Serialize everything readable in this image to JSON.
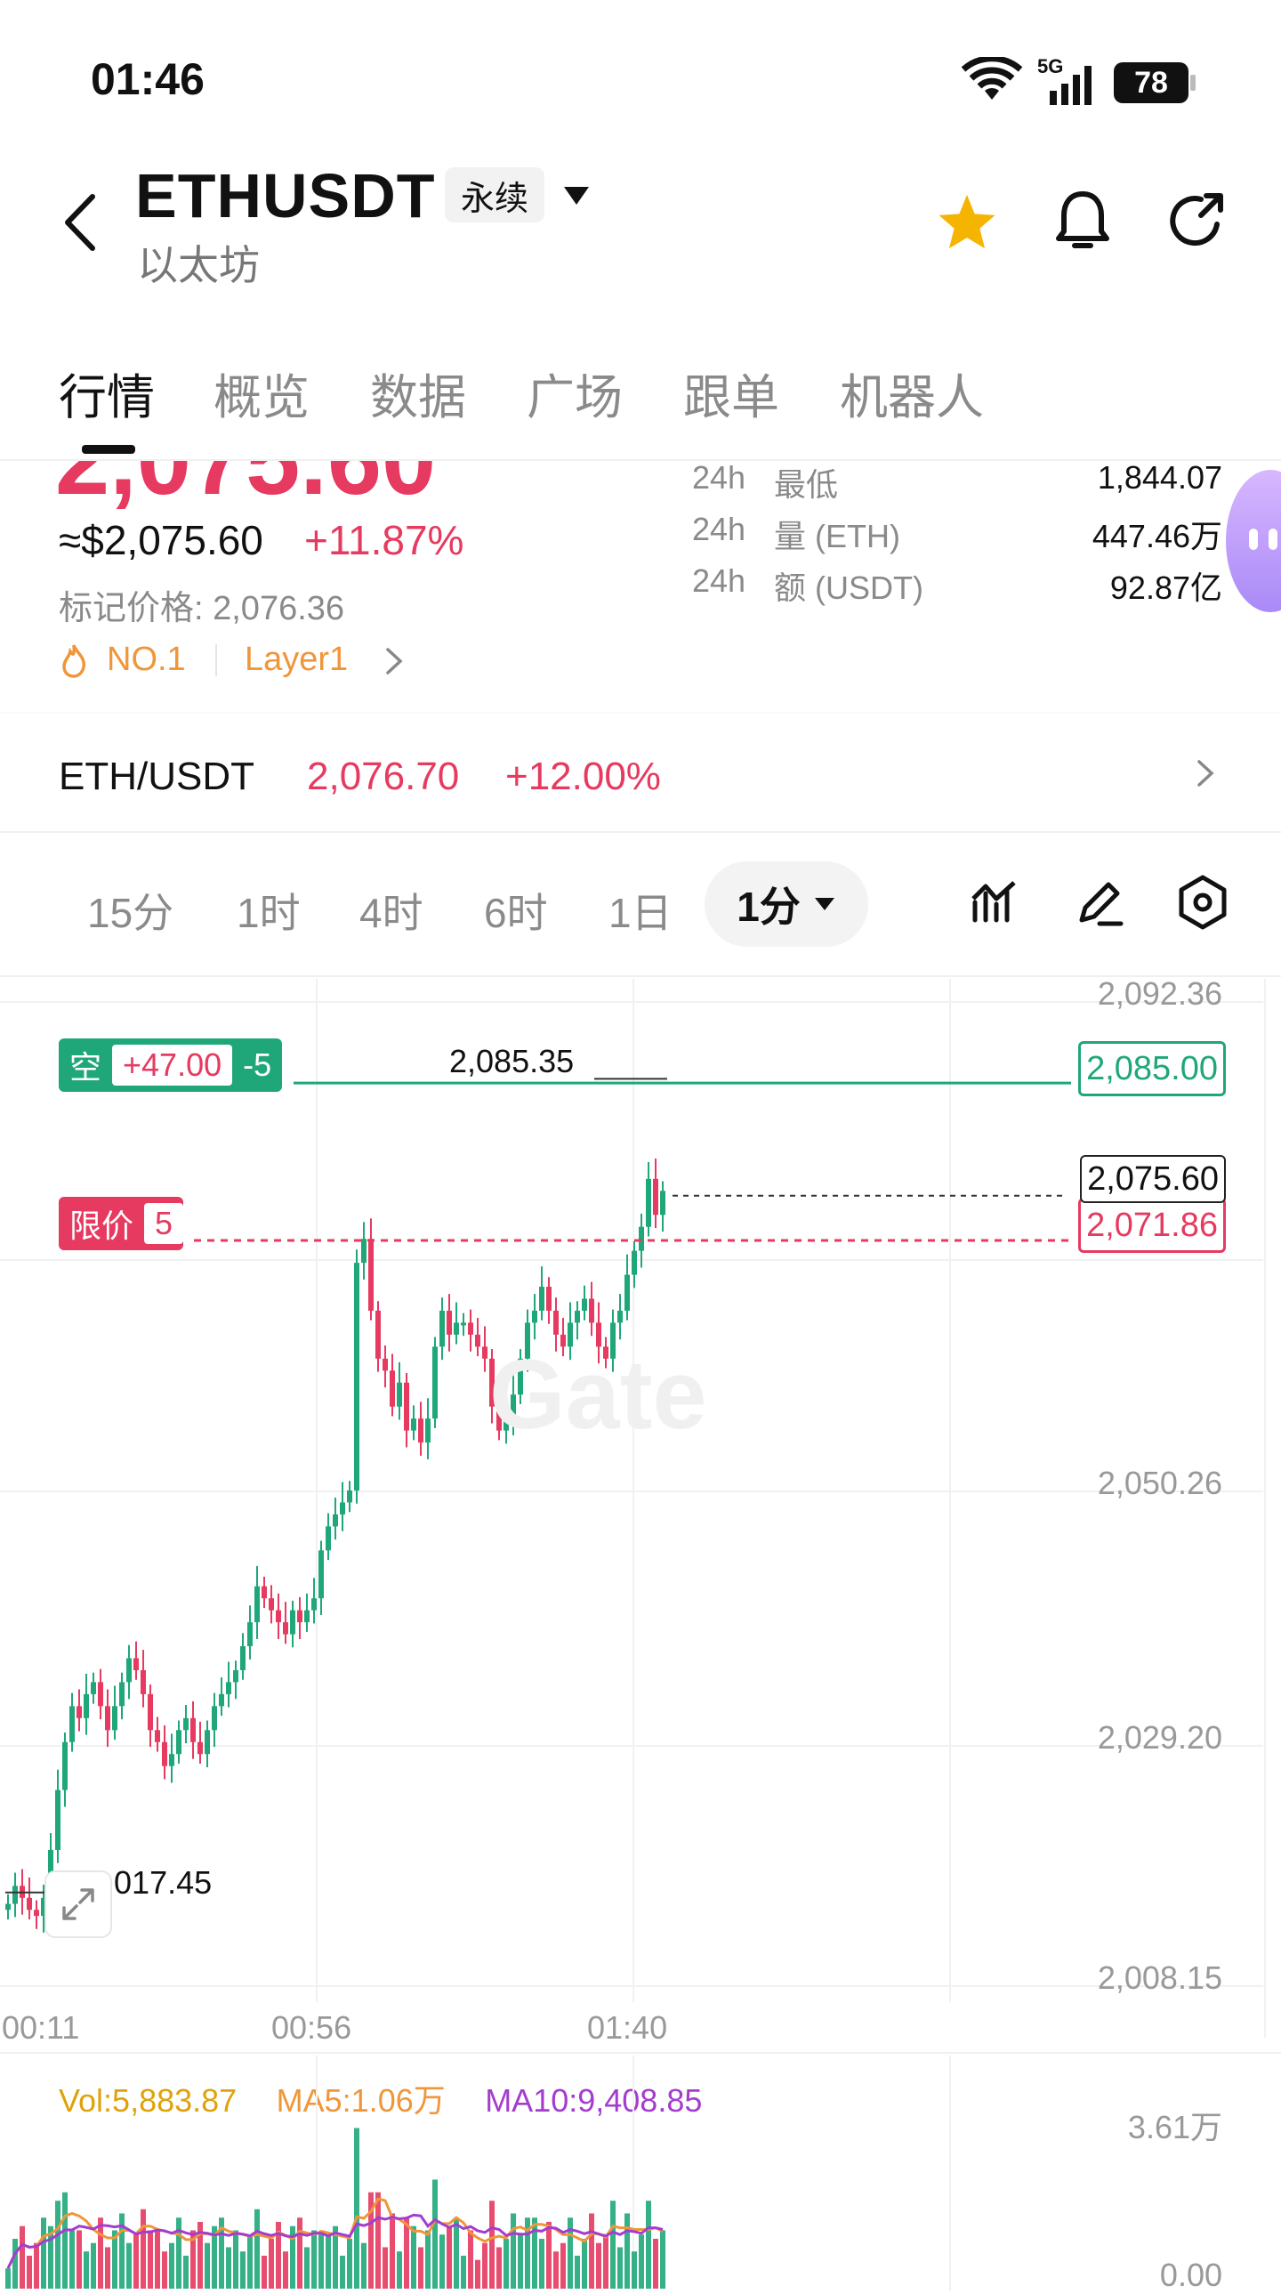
{
  "status_bar": {
    "time": "01:46",
    "network": "5G",
    "battery": "78"
  },
  "header": {
    "symbol": "ETHUSDT",
    "contract_type": "永续",
    "subtitle": "以太坊"
  },
  "tabs": [
    {
      "label": "行情",
      "active": true
    },
    {
      "label": "概览",
      "active": false
    },
    {
      "label": "数据",
      "active": false
    },
    {
      "label": "广场",
      "active": false
    },
    {
      "label": "跟单",
      "active": false
    },
    {
      "label": "机器人",
      "active": false
    }
  ],
  "ticker": {
    "last_price_partial": "2,075.60",
    "usd_price": "≈$2,075.60",
    "change_pct": "+11.87%",
    "mark_price": "标记价格: 2,076.36",
    "rank": "NO.1",
    "category": "Layer1",
    "stats": [
      {
        "period": "24h",
        "label": "最低",
        "value": "1,844.07"
      },
      {
        "period": "24h",
        "label": "量 (ETH)",
        "value": "447.46万"
      },
      {
        "period": "24h",
        "label": "额 (USDT)",
        "value": "92.87亿"
      }
    ]
  },
  "spot_pair": {
    "name": "ETH/USDT",
    "price": "2,076.70",
    "change": "+12.00%"
  },
  "intervals": [
    "15分",
    "1时",
    "4时",
    "6时",
    "1日"
  ],
  "active_interval": "1分",
  "colors": {
    "up": "#1fa77a",
    "down": "#e63a60",
    "accent_star": "#f5b400"
  },
  "chart_data": {
    "type": "candlestick",
    "y_axis_ticks": [
      "2,092.36",
      "2,050.26",
      "2,029.20",
      "2,008.15"
    ],
    "x_axis_ticks": [
      "00:11",
      "00:56",
      "01:40"
    ],
    "ylim": [
      2008.15,
      2092.36
    ],
    "high_marker": "2,085.35",
    "low_marker": "2,017.45",
    "current_price": "2,075.60",
    "position_line": {
      "side": "空",
      "pnl": "+47.00",
      "qty": "-5",
      "price": "2,085.00"
    },
    "limit_order_line": {
      "label": "限价",
      "qty": "5",
      "price": "2,071.86"
    },
    "close_series": [
      2016.5,
      2018,
      2017,
      2016,
      2015.5,
      2017,
      2021,
      2026,
      2030,
      2033,
      2032,
      2034,
      2035,
      2033,
      2031,
      2033,
      2035,
      2037,
      2036,
      2034,
      2031,
      2030,
      2028,
      2029,
      2031,
      2032,
      2030,
      2029,
      2031,
      2033,
      2034,
      2035,
      2036,
      2038,
      2040,
      2043,
      2042,
      2041,
      2040,
      2039,
      2041,
      2040,
      2041,
      2042,
      2046,
      2048,
      2049,
      2050,
      2051,
      2070,
      2072,
      2066,
      2062,
      2061,
      2058,
      2060,
      2056,
      2057,
      2055,
      2057,
      2063,
      2066,
      2064,
      2065,
      2065,
      2064,
      2063,
      2062,
      2058,
      2056,
      2057,
      2059,
      2062,
      2065,
      2066,
      2068,
      2066,
      2064,
      2063,
      2065,
      2066,
      2067,
      2065,
      2063,
      2062,
      2065,
      2066,
      2069,
      2071,
      2073,
      2077,
      2074,
      2076
    ],
    "volume": {
      "legend": {
        "vol": "Vol:5,883.87",
        "ma5": "MA5:1.06万",
        "ma10": "MA10:9,408.85"
      },
      "y_ticks": [
        "3.61万",
        "0.00"
      ]
    }
  }
}
